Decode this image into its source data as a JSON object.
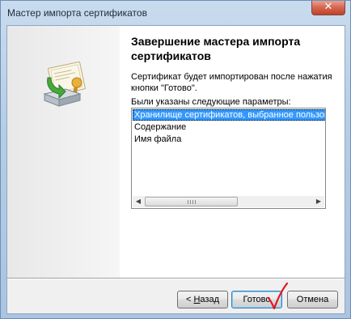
{
  "window": {
    "title": "Мастер импорта сертификатов"
  },
  "icons": {
    "close": "close-icon",
    "certificate": "certificate-import-icon",
    "checkmark": "red-checkmark-annotation"
  },
  "page": {
    "title": "Завершение мастера импорта сертификатов",
    "info": "Сертификат будет импортирован после нажатия кнопки \"Готово\".",
    "params_label": "Были указаны следующие параметры:"
  },
  "params": {
    "items": [
      "Хранилище сертификатов, выбранное пользователем",
      "Содержание",
      "Имя файла"
    ],
    "selected_index": 0
  },
  "buttons": {
    "back_prefix": "< ",
    "back_underlined": "Н",
    "back_rest": "азад",
    "finish": "Готово",
    "cancel": "Отмена"
  },
  "colors": {
    "selection": "#3399ff",
    "annotation": "#e4141f",
    "close": "#c24128"
  }
}
